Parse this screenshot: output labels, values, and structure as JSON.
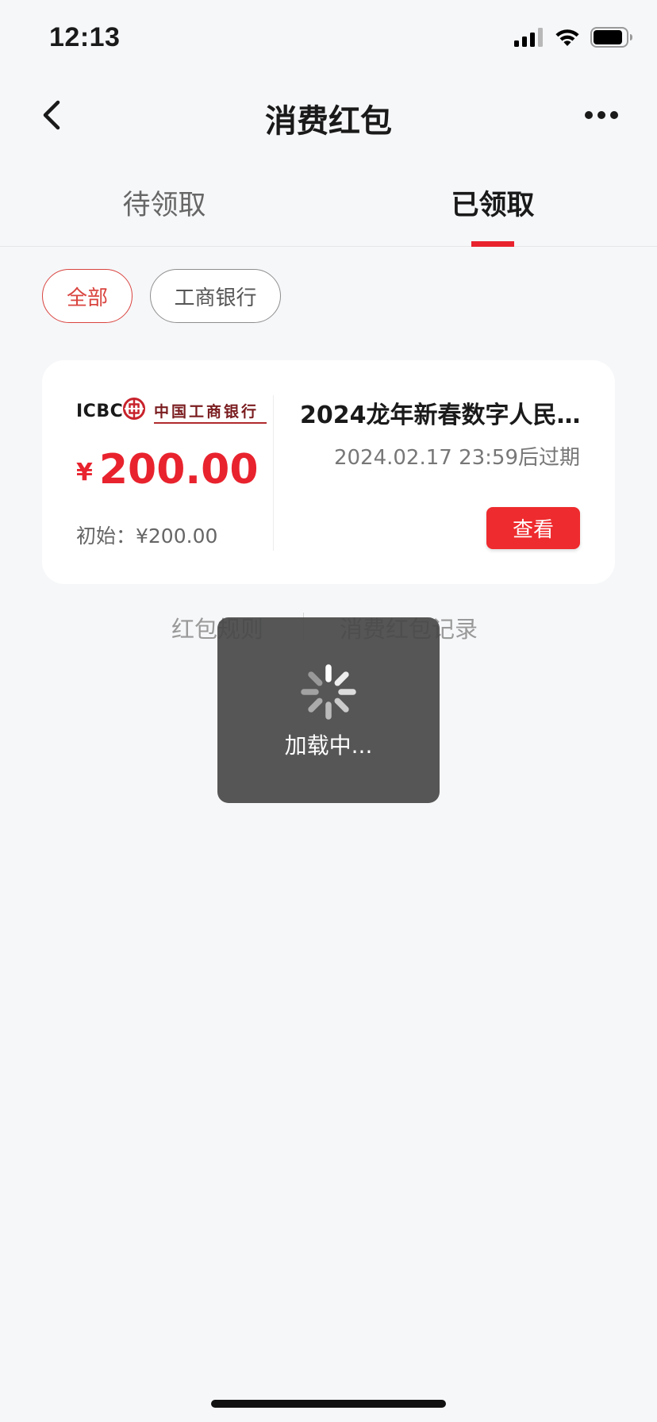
{
  "status_bar": {
    "time": "12:13"
  },
  "nav": {
    "title": "消费红包",
    "back_icon": "chevron-left-icon",
    "more_icon": "more-horizontal-icon"
  },
  "tabs": [
    {
      "label": "待领取",
      "active": false
    },
    {
      "label": "已领取",
      "active": true
    }
  ],
  "filters": [
    {
      "label": "全部",
      "selected": true
    },
    {
      "label": "工商银行",
      "selected": false
    }
  ],
  "card": {
    "bank_logo_en": "ICBC",
    "bank_logo_cn": "中国工商银行",
    "currency_symbol": "¥",
    "amount": "200.00",
    "initial": "初始：¥200.00",
    "title": "2024龙年新春数字人民…",
    "expiry": "2024.02.17 23:59后过期",
    "view_button": "查看"
  },
  "links": {
    "rules": "红包规则",
    "records": "消费红包记录"
  },
  "loading": {
    "text": "加载中..."
  },
  "colors": {
    "accent": "#e8232e",
    "background": "#f6f7f9",
    "toast": "#484848"
  }
}
